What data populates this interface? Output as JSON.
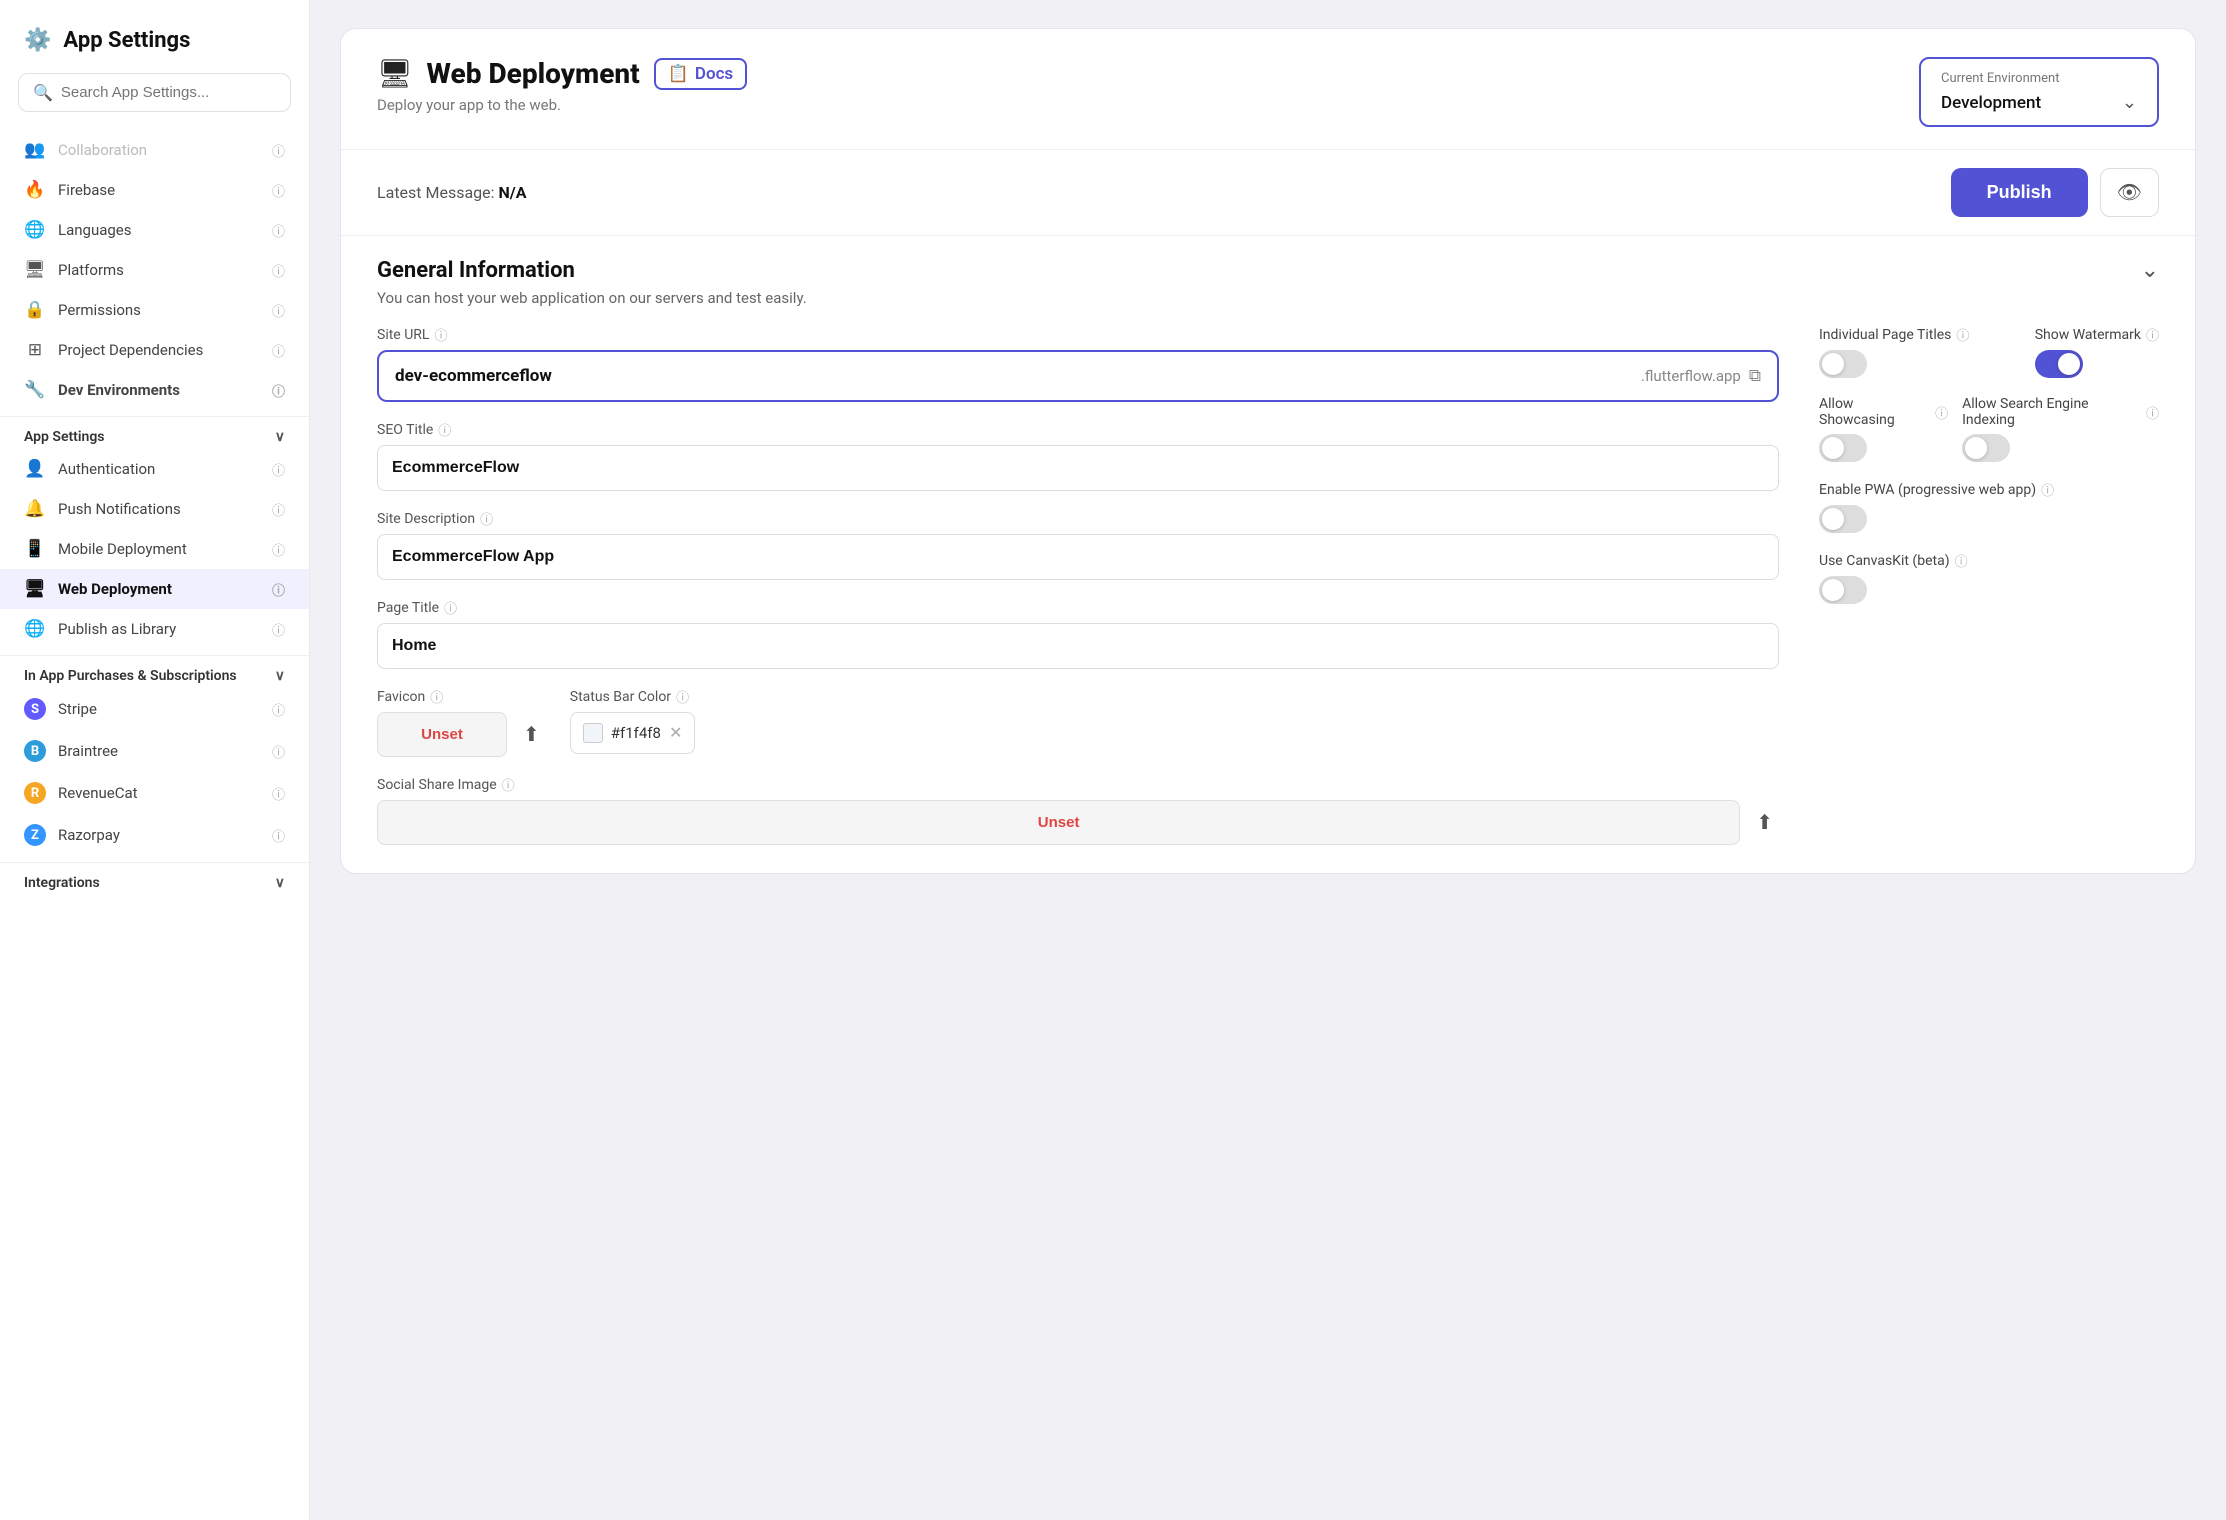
{
  "sidebar": {
    "title": "App Settings",
    "search_placeholder": "Search App Settings...",
    "items": [
      {
        "id": "collaboration",
        "icon": "👥",
        "label": "Collaboration",
        "greyed": true
      },
      {
        "id": "firebase",
        "icon": "🔥",
        "label": "Firebase",
        "greyed": false
      },
      {
        "id": "languages",
        "icon": "🌐",
        "label": "Languages",
        "greyed": false
      },
      {
        "id": "platforms",
        "icon": "🖥",
        "label": "Platforms",
        "greyed": false
      },
      {
        "id": "permissions",
        "icon": "🔒",
        "label": "Permissions",
        "greyed": false
      },
      {
        "id": "project-dependencies",
        "icon": "⊞",
        "label": "Project Dependencies",
        "greyed": false
      },
      {
        "id": "dev-environments",
        "icon": "🔧",
        "label": "Dev Environments",
        "greyed": false,
        "active": false,
        "bold": true
      }
    ],
    "app_settings_section": "App Settings",
    "app_settings_items": [
      {
        "id": "authentication",
        "icon": "👤",
        "label": "Authentication"
      },
      {
        "id": "push-notifications",
        "icon": "🔔",
        "label": "Push Notifications"
      },
      {
        "id": "mobile-deployment",
        "icon": "📱",
        "label": "Mobile Deployment"
      },
      {
        "id": "web-deployment",
        "icon": "🖥",
        "label": "Web Deployment",
        "active": true
      },
      {
        "id": "publish-as-library",
        "icon": "🌐",
        "label": "Publish as Library"
      }
    ],
    "in_app_section": "In App Purchases & Subscriptions",
    "in_app_items": [
      {
        "id": "stripe",
        "icon": "S",
        "label": "Stripe"
      },
      {
        "id": "braintree",
        "icon": "B",
        "label": "Braintree"
      },
      {
        "id": "revenuecat",
        "icon": "R",
        "label": "RevenueCat"
      },
      {
        "id": "razorpay",
        "icon": "Z",
        "label": "Razorpay"
      }
    ],
    "integrations_section": "Integrations"
  },
  "main": {
    "page_title": "Web Deployment",
    "page_icon": "🖥",
    "docs_label": "Docs",
    "page_subtitle": "Deploy your app to the web.",
    "env": {
      "label": "Current Environment",
      "value": "Development"
    },
    "latest_message_label": "Latest Message:",
    "latest_message_value": "N/A",
    "publish_button": "Publish",
    "general_info": {
      "title": "General Information",
      "description": "You can host your web application on our servers and test easily.",
      "site_url_label": "Site URL",
      "site_url_value": "dev-ecommerceflow",
      "site_url_suffix": ".flutterflow.app",
      "seo_title_label": "SEO Title",
      "seo_title_value": "EcommerceFlow",
      "site_description_label": "Site Description",
      "site_description_value": "EcommerceFlow App",
      "page_title_label": "Page Title",
      "page_title_value": "Home",
      "favicon_label": "Favicon",
      "favicon_unset": "Unset",
      "status_bar_label": "Status Bar Color",
      "status_bar_value": "#f1f4f8",
      "social_share_label": "Social Share Image",
      "social_share_unset": "Unset"
    },
    "right_panel": {
      "individual_page_titles_label": "Individual Page Titles",
      "show_watermark_label": "Show Watermark",
      "show_watermark_on": true,
      "individual_page_titles_on": false,
      "allow_showcasing_label": "Allow Showcasing",
      "allow_showcasing_on": false,
      "allow_search_engine_label": "Allow Search Engine Indexing",
      "allow_search_engine_on": false,
      "enable_pwa_label": "Enable PWA (progressive web app)",
      "enable_pwa_on": false,
      "use_canvaskit_label": "Use CanvasKit (beta)",
      "use_canvaskit_on": false
    }
  }
}
